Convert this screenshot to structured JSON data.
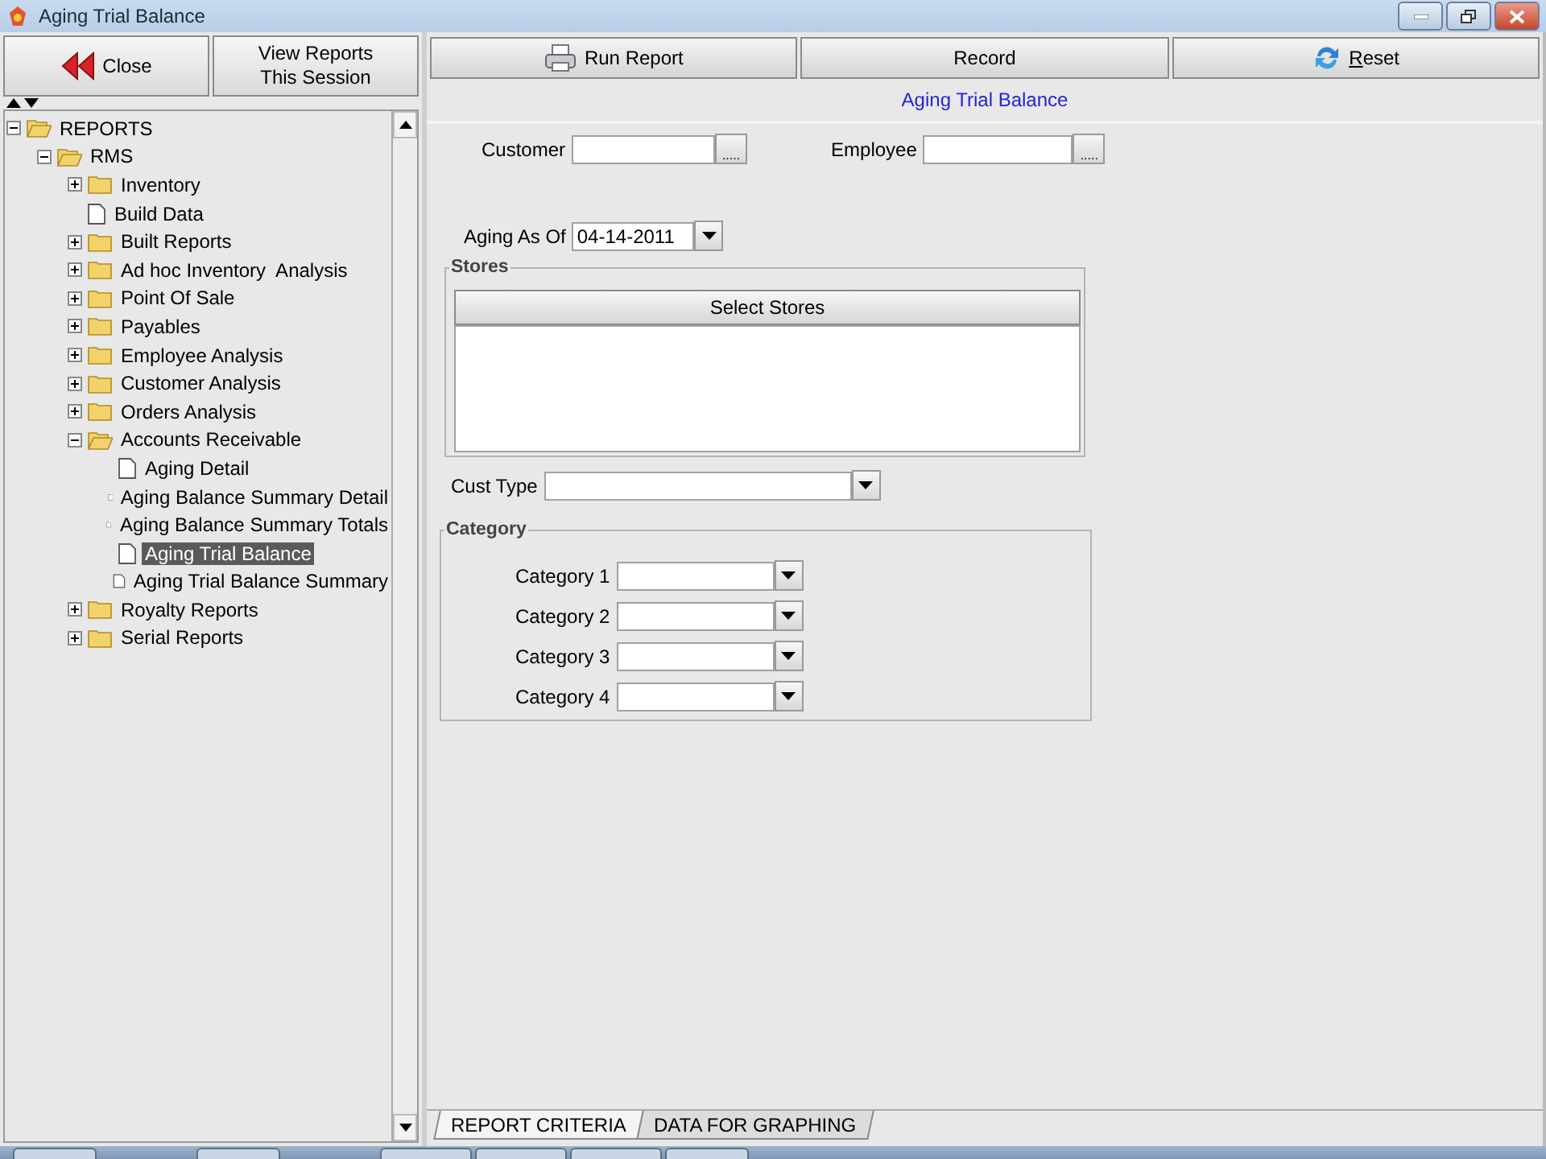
{
  "window": {
    "title": "Aging Trial Balance"
  },
  "left_buttons": [
    {
      "label": "Close"
    },
    {
      "label": "View Reports\nThis Session"
    }
  ],
  "tree": [
    {
      "label": "REPORTS",
      "kind": "folder",
      "expanded": true,
      "selected": false,
      "children": [
        {
          "label": "RMS",
          "kind": "folder",
          "expanded": true,
          "selected": false,
          "children": [
            {
              "label": "Inventory",
              "kind": "folder",
              "expanded": false,
              "selected": false
            },
            {
              "label": "Build Data",
              "kind": "file",
              "selected": false
            },
            {
              "label": "Built Reports",
              "kind": "folder",
              "expanded": false,
              "selected": false
            },
            {
              "label": "Ad hoc Inventory  Analysis",
              "kind": "folder",
              "expanded": false,
              "selected": false
            },
            {
              "label": "Point Of Sale",
              "kind": "folder",
              "expanded": false,
              "selected": false
            },
            {
              "label": "Payables",
              "kind": "folder",
              "expanded": false,
              "selected": false
            },
            {
              "label": "Employee Analysis",
              "kind": "folder",
              "expanded": false,
              "selected": false
            },
            {
              "label": "Customer Analysis",
              "kind": "folder",
              "expanded": false,
              "selected": false
            },
            {
              "label": "Orders Analysis",
              "kind": "folder",
              "expanded": false,
              "selected": false
            },
            {
              "label": "Accounts Receivable",
              "kind": "folder",
              "expanded": true,
              "selected": false,
              "children": [
                {
                  "label": "Aging Detail",
                  "kind": "file",
                  "selected": false
                },
                {
                  "label": "Aging Balance Summary Detail",
                  "kind": "file",
                  "selected": false
                },
                {
                  "label": "Aging Balance Summary Totals",
                  "kind": "file",
                  "selected": false
                },
                {
                  "label": "Aging Trial Balance",
                  "kind": "file",
                  "selected": true
                },
                {
                  "label": "Aging Trial Balance Summary",
                  "kind": "file",
                  "selected": false
                }
              ]
            },
            {
              "label": "Royalty Reports",
              "kind": "folder",
              "expanded": false,
              "selected": false
            },
            {
              "label": "Serial Reports",
              "kind": "folder",
              "expanded": false,
              "selected": false
            }
          ]
        }
      ]
    }
  ],
  "toolbar": [
    {
      "label": "Run Report",
      "underline_first": false
    },
    {
      "label": "Record",
      "underline_first": false
    },
    {
      "label": "Reset",
      "underline_first": true
    }
  ],
  "report_title": "Aging Trial Balance",
  "customer": {
    "label": "Customer",
    "browse": "....."
  },
  "employee": {
    "label": "Employee",
    "browse": "....."
  },
  "aging_as_of": {
    "label": "Aging As Of",
    "value": "04-14-2011"
  },
  "stores": {
    "title": "Stores",
    "button": "Select Stores"
  },
  "cust_type": {
    "label": "Cust Type"
  },
  "category": {
    "title": "Category",
    "rows": [
      {
        "label": "Category 1"
      },
      {
        "label": "Category 2"
      },
      {
        "label": "Category 3"
      },
      {
        "label": "Category 4"
      }
    ]
  },
  "tabs": [
    {
      "label": "REPORT CRITERIA",
      "selected": true
    },
    {
      "label": "DATA FOR GRAPHING",
      "selected": false
    }
  ]
}
